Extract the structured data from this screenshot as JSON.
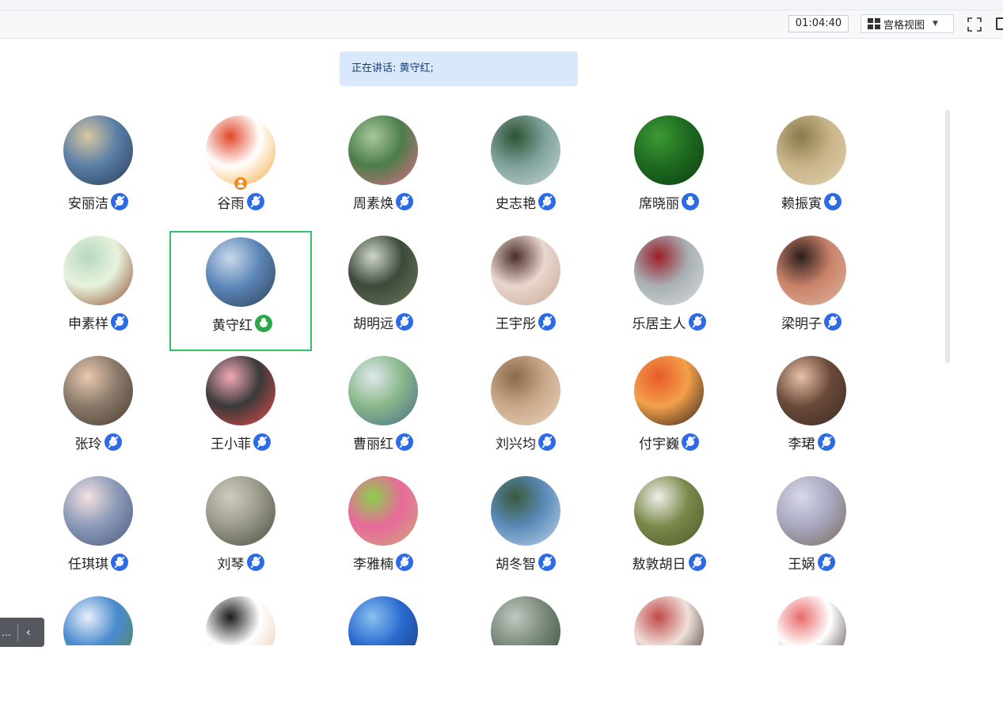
{
  "window": {
    "title_fragment": ""
  },
  "toolbar": {
    "timer": "01:04:40",
    "view_label": "宫格视图",
    "caret": "▼"
  },
  "banner": {
    "text": "正在讲话: 黄守红;"
  },
  "participants": [
    {
      "name": "安丽洁",
      "mic": "muted",
      "avatar": "beach-photo",
      "colors": [
        "#5a7fa8",
        "#d9c7a0",
        "#2b3b52"
      ]
    },
    {
      "name": "谷雨",
      "mic": "muted",
      "avatar": "cartoon-red-hood",
      "host": true,
      "colors": [
        "#ffffff",
        "#e2482b",
        "#f6a63a"
      ]
    },
    {
      "name": "周素焕",
      "mic": "muted",
      "avatar": "pink-flower",
      "colors": [
        "#4c7d4a",
        "#a8c79b",
        "#e36a8a"
      ]
    },
    {
      "name": "史志艳",
      "mic": "muted",
      "avatar": "lake-trees",
      "colors": [
        "#7fa19c",
        "#2f5233",
        "#c7d6d4"
      ]
    },
    {
      "name": "席晓丽",
      "mic": "on-blue",
      "avatar": "green-leaf",
      "colors": [
        "#1f6b21",
        "#3c9a34",
        "#0c3d10"
      ]
    },
    {
      "name": "赖振寅",
      "mic": "on-blue",
      "avatar": "painting",
      "colors": [
        "#c9b48a",
        "#8a7a4c",
        "#e0d2b0"
      ]
    },
    {
      "name": "申素样",
      "mic": "muted",
      "avatar": "girl-illustration",
      "colors": [
        "#e8f3dc",
        "#b7d7c0",
        "#8a4a2e"
      ]
    },
    {
      "name": "黄守红",
      "mic": "speaking",
      "avatar": "city-towers",
      "active": true,
      "colors": [
        "#5c86b8",
        "#c9d9ea",
        "#2d3f52"
      ]
    },
    {
      "name": "胡明远",
      "mic": "muted",
      "avatar": "table-photo",
      "colors": [
        "#3d4a3a",
        "#cfd6cc",
        "#6b7a5c"
      ]
    },
    {
      "name": "王宇彤",
      "mic": "muted",
      "avatar": "girl-portrait",
      "colors": [
        "#e9d6cc",
        "#4a2e28",
        "#c9a89a"
      ]
    },
    {
      "name": "乐居主人",
      "mic": "muted",
      "avatar": "wine-glass",
      "colors": [
        "#a8b0b5",
        "#9b1e28",
        "#d9dcde"
      ]
    },
    {
      "name": "梁明子",
      "mic": "muted",
      "avatar": "woman-dark",
      "colors": [
        "#c9826a",
        "#2b1e1c",
        "#e0b59e"
      ]
    },
    {
      "name": "张玲",
      "mic": "muted",
      "avatar": "baby-photo",
      "colors": [
        "#8a7a6a",
        "#e8c8b0",
        "#4a3a2e"
      ]
    },
    {
      "name": "王小菲",
      "mic": "muted",
      "avatar": "cartoon-pigs",
      "colors": [
        "#3a3a3a",
        "#f3a8b8",
        "#e84b4b"
      ]
    },
    {
      "name": "曹丽红",
      "mic": "muted",
      "avatar": "girl-outdoor",
      "colors": [
        "#8ab88a",
        "#e0e8ee",
        "#4a6a8a"
      ]
    },
    {
      "name": "刘兴均",
      "mic": "muted",
      "avatar": "sketch-kids",
      "colors": [
        "#c9a88a",
        "#8a6a4a",
        "#e8d2bc"
      ]
    },
    {
      "name": "付宇巍",
      "mic": "muted",
      "avatar": "sunset-girl",
      "colors": [
        "#f3a04a",
        "#e85a2a",
        "#2a1e1a"
      ]
    },
    {
      "name": "李珺",
      "mic": "muted",
      "avatar": "toddler-smile",
      "colors": [
        "#6a4a3a",
        "#e8c0a8",
        "#3a2a20"
      ]
    },
    {
      "name": "任琪琪",
      "mic": "muted",
      "avatar": "cartoon-cat",
      "colors": [
        "#8a9ab8",
        "#f5e0e0",
        "#4a5a78"
      ]
    },
    {
      "name": "刘琴",
      "mic": "muted",
      "avatar": "fountain-photo",
      "colors": [
        "#9a9a8a",
        "#d0ccc0",
        "#4a4a40"
      ]
    },
    {
      "name": "李雅楠",
      "mic": "muted",
      "avatar": "art-portrait",
      "colors": [
        "#e86a9a",
        "#8ad04a",
        "#c9a87a"
      ]
    },
    {
      "name": "胡冬智",
      "mic": "muted",
      "avatar": "park-building",
      "colors": [
        "#5a8ab8",
        "#3a5a3a",
        "#c0d4e8"
      ]
    },
    {
      "name": "敖敦胡日",
      "mic": "muted",
      "avatar": "white-goat",
      "colors": [
        "#7a8a4a",
        "#f0f0ea",
        "#4a5a2a"
      ]
    },
    {
      "name": "王娲",
      "mic": "muted",
      "avatar": "wall-figure",
      "colors": [
        "#a8a8c0",
        "#d8d8e8",
        "#7a6a5a"
      ]
    },
    {
      "name": "",
      "mic": "none",
      "avatar": "mountain-sky",
      "colors": [
        "#4a8ad0",
        "#e8f0f8",
        "#5a8a4a"
      ]
    },
    {
      "name": "",
      "mic": "none",
      "avatar": "woman-headshot",
      "colors": [
        "#ffffff",
        "#1a1a1a",
        "#e8c8b0"
      ]
    },
    {
      "name": "",
      "mic": "none",
      "avatar": "blue-photo",
      "colors": [
        "#2a6ad0",
        "#8ac0f0",
        "#1a3a7a"
      ]
    },
    {
      "name": "",
      "mic": "none",
      "avatar": "tree-photo",
      "colors": [
        "#7a8a7a",
        "#c0c8c0",
        "#3a4a3a"
      ]
    },
    {
      "name": "",
      "mic": "none",
      "avatar": "woman-costume",
      "colors": [
        "#f0e0d8",
        "#c04a4a",
        "#3a2a2a"
      ]
    },
    {
      "name": "",
      "mic": "none",
      "avatar": "cartoon-couple",
      "colors": [
        "#ffffff",
        "#e86a6a",
        "#4a3a3a"
      ]
    }
  ],
  "side_panel": {
    "dots": "…",
    "arrow": "‹"
  }
}
